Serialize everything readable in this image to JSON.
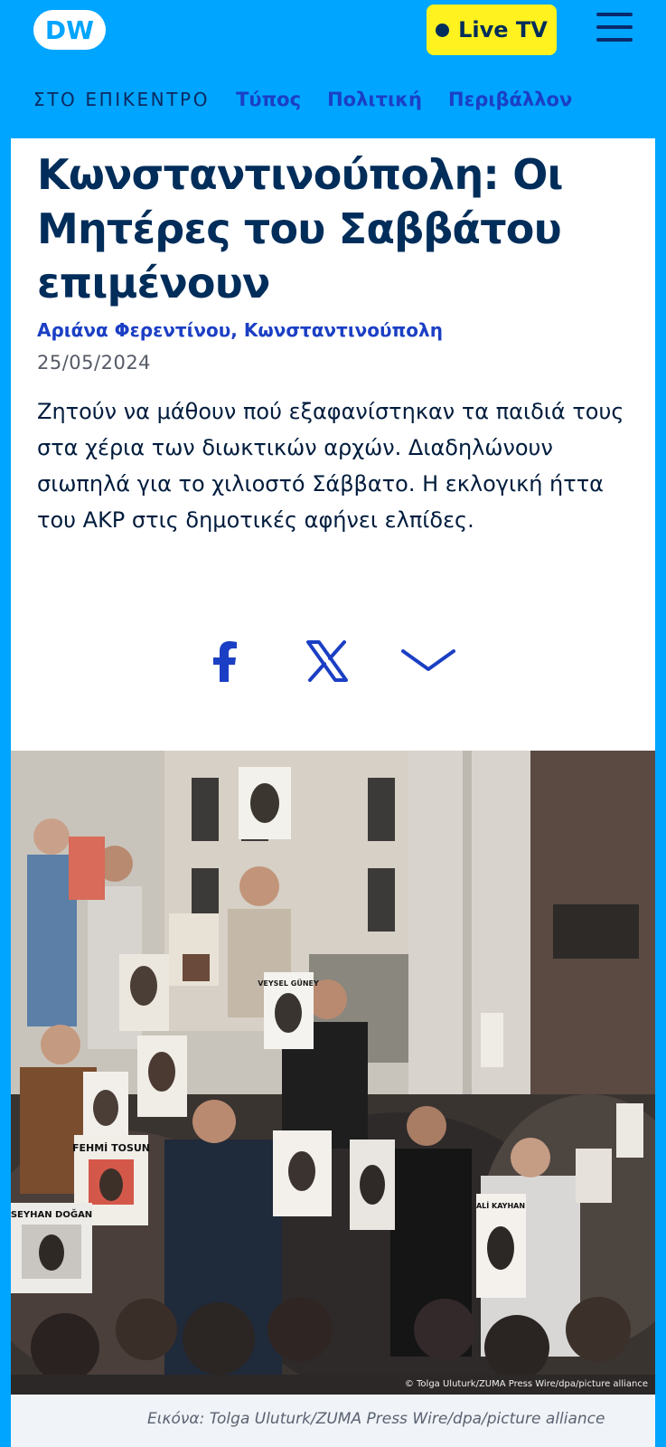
{
  "header": {
    "logo_text": "DW",
    "live_label": "Live TV",
    "menu_icon": "hamburger-icon"
  },
  "nav": {
    "label": "ΣΤΟ ΕΠΙΚΕΝΤΡΟ",
    "links": [
      "Τύπος",
      "Πολιτική",
      "Περιβάλλον"
    ]
  },
  "article": {
    "title": "Κωνσταντινούπολη: Οι Μητέρες του Σαββάτου επιμένουν",
    "author": "Αριάνα Φερεντίνου, Κωνσταντινούπολη",
    "date": "25/05/2024",
    "lead": "Ζητούν να μάθουν πού εξαφανίστηκαν τα παιδιά τους στα χέρια των διωκτικών αρχών. Διαδηλώνουν σιωπηλά για το χιλιοστό Σάββατο. Η εκλογική ήττα του AKP στις δημοτικές αφήνει ελπίδες."
  },
  "share": {
    "icons": [
      "facebook-icon",
      "x-icon",
      "chevron-down-icon"
    ]
  },
  "photo": {
    "signs": [
      "VEYSEL GÜNEY",
      "FEHMİ TOSUN",
      "SEYHAN DOĞAN",
      "ALİ KAYHAN"
    ],
    "credit_overlay": "© Tolga Uluturk/ZUMA Press Wire/dpa/picture alliance",
    "caption": "Εικόνα: Tolga Uluturk/ZUMA Press Wire/dpa/picture alliance"
  },
  "colors": {
    "header_bg": "#00a5ff",
    "live_bg": "#fff21f",
    "title": "#002d5a",
    "link": "#1b3fc4"
  }
}
